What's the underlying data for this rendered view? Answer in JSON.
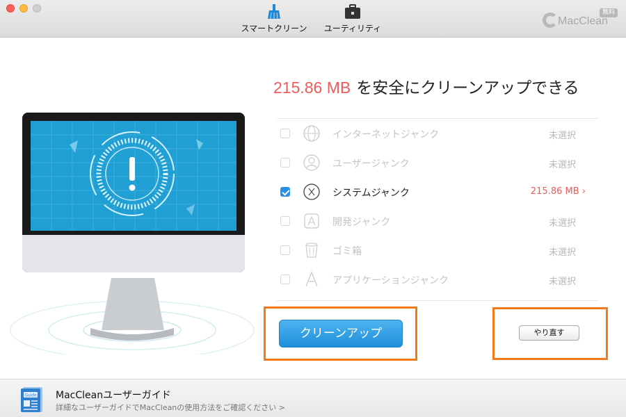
{
  "toolbar": {
    "smart_clean_label": "スマートクリーン",
    "utility_label": "ユーティリティ"
  },
  "brand": {
    "name": "MacClean",
    "badge": "無料"
  },
  "headline": {
    "amount": "215.86 MB",
    "text": "を安全にクリーンアップできる"
  },
  "items": [
    {
      "label": "インターネットジャンク",
      "status": "未選択",
      "checked": false,
      "icon": "globe-icon"
    },
    {
      "label": "ユーザージャンク",
      "status": "未選択",
      "checked": false,
      "icon": "user-icon"
    },
    {
      "label": "システムジャンク",
      "status": "215.86 MB",
      "checked": true,
      "icon": "system-x-icon"
    },
    {
      "label": "開発ジャンク",
      "status": "未選択",
      "checked": false,
      "icon": "developer-icon"
    },
    {
      "label": "ゴミ箱",
      "status": "未選択",
      "checked": false,
      "icon": "trash-icon"
    },
    {
      "label": "アプリケーションジャンク",
      "status": "未選択",
      "checked": false,
      "icon": "app-icon"
    }
  ],
  "actions": {
    "clean_label": "クリーンアップ",
    "reset_label": "やり直す"
  },
  "footer": {
    "guide_icon_text": "Guide",
    "title": "MacCleanユーザーガイド",
    "description": "詳細なユーザーガイドでMacCleanの使用方法をご確認ください >"
  },
  "colors": {
    "accent_blue": "#2b8fe3",
    "amount_red": "#f05a5a",
    "highlight_orange": "#f27a1a"
  }
}
